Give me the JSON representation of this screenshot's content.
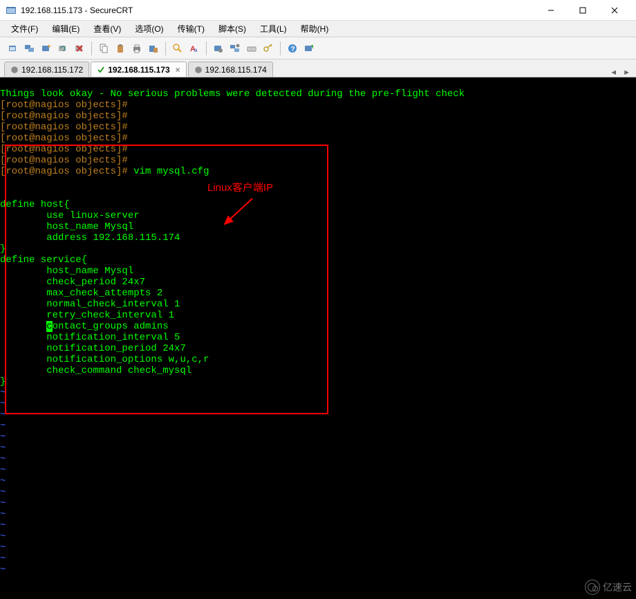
{
  "window": {
    "title": "192.168.115.173 - SecureCRT"
  },
  "menu": {
    "file": "文件(F)",
    "edit": "编辑(E)",
    "view": "查看(V)",
    "options": "选项(O)",
    "transfer": "传输(T)",
    "script": "脚本(S)",
    "tools": "工具(L)",
    "help": "帮助(H)"
  },
  "toolbar_icons": [
    "new-session-icon",
    "multi-session-icon",
    "quick-connect-icon",
    "reconnect-icon",
    "disconnect-icon",
    "copy-icon",
    "paste-icon",
    "print-icon",
    "paste-clipboard-icon",
    "find-icon",
    "font-icon",
    "session-options-icon",
    "global-options-icon",
    "keyboard-icon",
    "key-icon",
    "help-icon",
    "about-icon"
  ],
  "tabs": [
    {
      "label": "192.168.115.172",
      "active": false,
      "status": "connected"
    },
    {
      "label": "192.168.115.173",
      "active": true,
      "status": "connected"
    },
    {
      "label": "192.168.115.174",
      "active": false,
      "status": "connected"
    }
  ],
  "terminal": {
    "header": "Things look okay - No serious problems were detected during the pre-flight check",
    "prompt": "[root@nagios objects]#",
    "command": "vim mysql.cfg",
    "cfg": {
      "host_open": "define host{",
      "host_use": "        use linux-server",
      "host_name": "        host_name Mysql",
      "host_addr": "        address 192.168.115.174",
      "close": "}",
      "svc_open": "define service{",
      "svc_host": "        host_name Mysql",
      "svc_period": "        check_period 24x7",
      "svc_max": "        max_check_attempts 2",
      "svc_normal": "        normal_check_interval 1",
      "svc_retry": "        retry_check_interval 1",
      "svc_contact_pre": "        ",
      "svc_contact_c": "c",
      "svc_contact_post": "ontact_groups admins",
      "svc_notif_int": "        notification_interval 5",
      "svc_notif_per": "        notification_period 24x7",
      "svc_notif_opt": "        notification_options w,u,c,r",
      "svc_check": "        check_command check_mysql"
    },
    "tilde": "~"
  },
  "annotation": {
    "label": "Linux客户端IP"
  },
  "watermark": {
    "text": "亿速云"
  }
}
